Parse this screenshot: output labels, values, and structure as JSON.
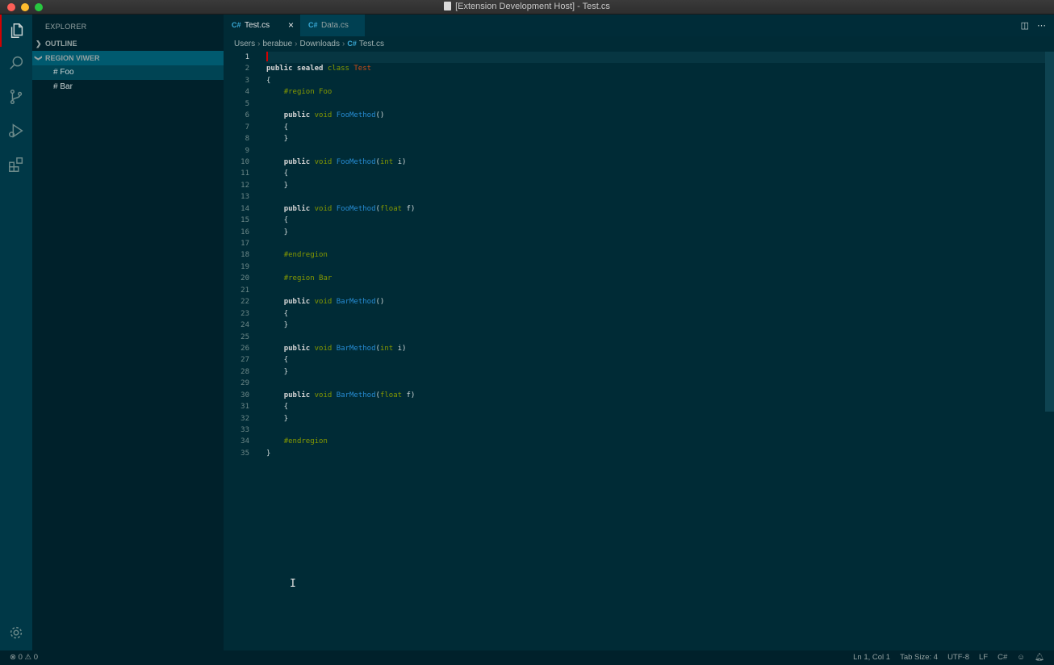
{
  "window": {
    "title": "[Extension Development Host] - Test.cs"
  },
  "sidebar": {
    "title": "EXPLORER",
    "sections": [
      {
        "label": "OUTLINE",
        "collapsed": true
      },
      {
        "label": "REGION VIWER",
        "collapsed": false
      }
    ],
    "regions": [
      "# Foo",
      "# Bar"
    ]
  },
  "tabs": [
    {
      "label": "Test.cs",
      "active": true,
      "close": "×"
    },
    {
      "label": "Data.cs",
      "active": false
    }
  ],
  "breadcrumb": {
    "parts": [
      "Users",
      "berabue",
      "Downloads"
    ],
    "file": "Test.cs"
  },
  "editor": {
    "line_numbers": [
      "1",
      "2",
      "3",
      "4",
      "5",
      "6",
      "7",
      "8",
      "9",
      "10",
      "11",
      "12",
      "13",
      "14",
      "15",
      "16",
      "17",
      "18",
      "19",
      "20",
      "21",
      "22",
      "23",
      "24",
      "25",
      "26",
      "27",
      "28",
      "29",
      "30",
      "31",
      "32",
      "33",
      "34",
      "35"
    ],
    "current_line": 1
  },
  "status": {
    "errors": "0",
    "warnings": "0",
    "position": "Ln 1, Col 1",
    "tab_size": "Tab Size: 4",
    "encoding": "UTF-8",
    "eol": "LF",
    "language": "C#"
  },
  "icons": {
    "tab_file": "csharp-file-icon",
    "split": "split-editor-icon",
    "more": "more-actions-icon"
  }
}
